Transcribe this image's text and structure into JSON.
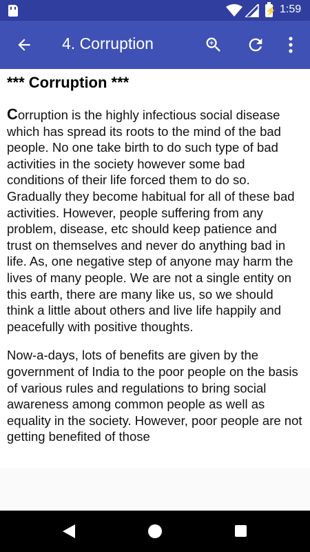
{
  "status_bar": {
    "time": "1:59",
    "battery_glyph": "⚡",
    "icons": [
      "sd-card-icon",
      "wifi-icon",
      "cell-signal-icon",
      "battery-charging-icon"
    ]
  },
  "app_bar": {
    "title": "4. Corruption",
    "icons": [
      "back-arrow-icon",
      "zoom-in-icon",
      "refresh-icon",
      "more-vert-icon"
    ]
  },
  "article": {
    "heading": "*** Corruption ***",
    "paragraphs": [
      {
        "dropcap": "C",
        "text": "orruption is the highly infectious social disease which has spread its roots to the mind of the bad people. No one take birth to do such type of bad activities in the society however some bad conditions of their life forced them to do so. Gradually they become habitual for all of these bad activities. However, people suffering from any problem, disease, etc should keep patience and trust on themselves and never do anything bad in life. As, one negative step of anyone may harm the lives of many people. We are not a single entity on this earth, there are many like us, so we should think a little about others and live life happily and peacefully with positive thoughts."
      },
      {
        "text": "Now-a-days, lots of benefits are given by the government of India to the poor people on the basis of various rules and regulations to bring social awareness among common people as well as equality in the society. However, poor people are not getting benefited of those"
      }
    ]
  },
  "nav_bar": {
    "icons": [
      "back-triangle-icon",
      "home-circle-icon",
      "recents-square-icon"
    ]
  },
  "colors": {
    "status_bar": "#303f9f",
    "app_bar": "#3f51b5",
    "content_bg": "#ffffff",
    "nav_bar": "#000000"
  }
}
